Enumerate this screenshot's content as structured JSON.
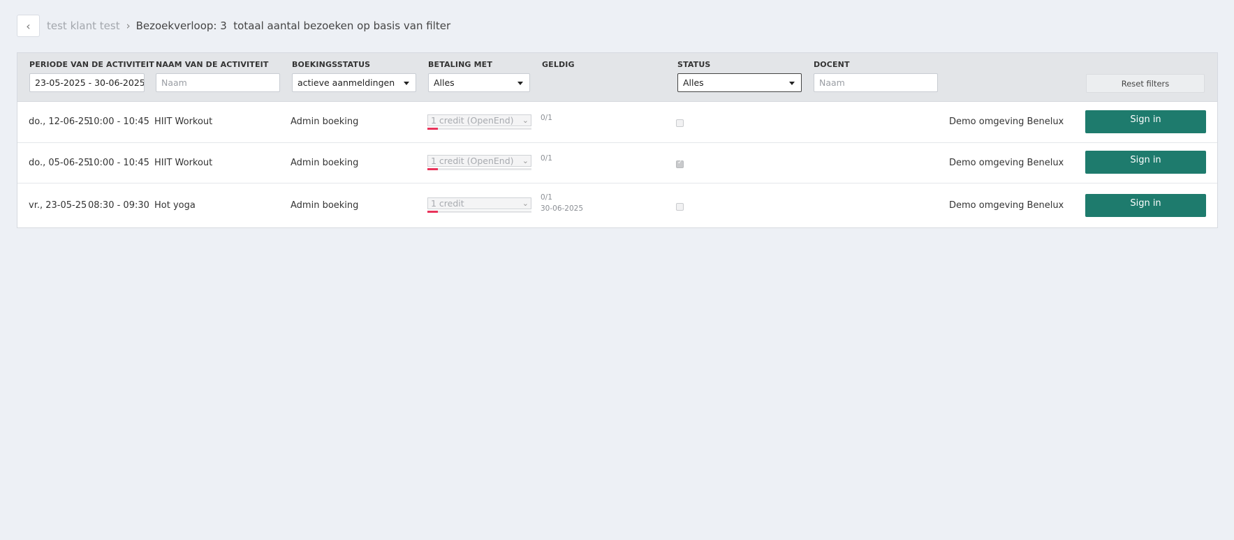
{
  "breadcrumb": {
    "back_icon": "chevron-left-icon",
    "parent": "test klant test",
    "separator": "›",
    "current": "Bezoekverloop: 3  totaal aantal bezoeken op basis van filter"
  },
  "filters": {
    "period": {
      "label": "PERIODE VAN DE ACTIVITEIT",
      "value": "23-05-2025 - 30-06-2025"
    },
    "activity_name": {
      "label": "NAAM VAN DE ACTIVITEIT",
      "placeholder": "Naam"
    },
    "booking_status": {
      "label": "BOEKINGSSTATUS",
      "value": "actieve aanmeldingen"
    },
    "payment": {
      "label": "BETALING MET",
      "value": "Alles"
    },
    "valid": {
      "label": "GELDIG"
    },
    "status": {
      "label": "STATUS",
      "value": "Alles"
    },
    "teacher": {
      "label": "DOCENT",
      "placeholder": "Naam"
    },
    "reset_label": "Reset filters"
  },
  "rows": [
    {
      "date": "do., 12-06-25",
      "time": "10:00 - 10:45",
      "activity": "HIIT Workout",
      "booking": "Admin boeking",
      "payment": "1 credit (OpenEnd)",
      "valid": "0/1",
      "valid_date": "",
      "checked": false,
      "location": "Demo omgeving Benelux",
      "action": "Sign in"
    },
    {
      "date": "do., 05-06-25",
      "time": "10:00 - 10:45",
      "activity": "HIIT Workout",
      "booking": "Admin boeking",
      "payment": "1 credit (OpenEnd)",
      "valid": "0/1",
      "valid_date": "",
      "checked": true,
      "location": "Demo omgeving Benelux",
      "action": "Sign in"
    },
    {
      "date": "vr., 23-05-25",
      "time": "08:30 - 09:30",
      "activity": "Hot yoga",
      "booking": "Admin boeking",
      "payment": "1 credit",
      "valid": "0/1",
      "valid_date": "30-06-2025",
      "checked": false,
      "location": "Demo omgeving Benelux",
      "action": "Sign in"
    }
  ],
  "colors": {
    "primary_button": "#1e7b6d",
    "usage_bar": "#e8335a",
    "background": "#edf0f5"
  }
}
